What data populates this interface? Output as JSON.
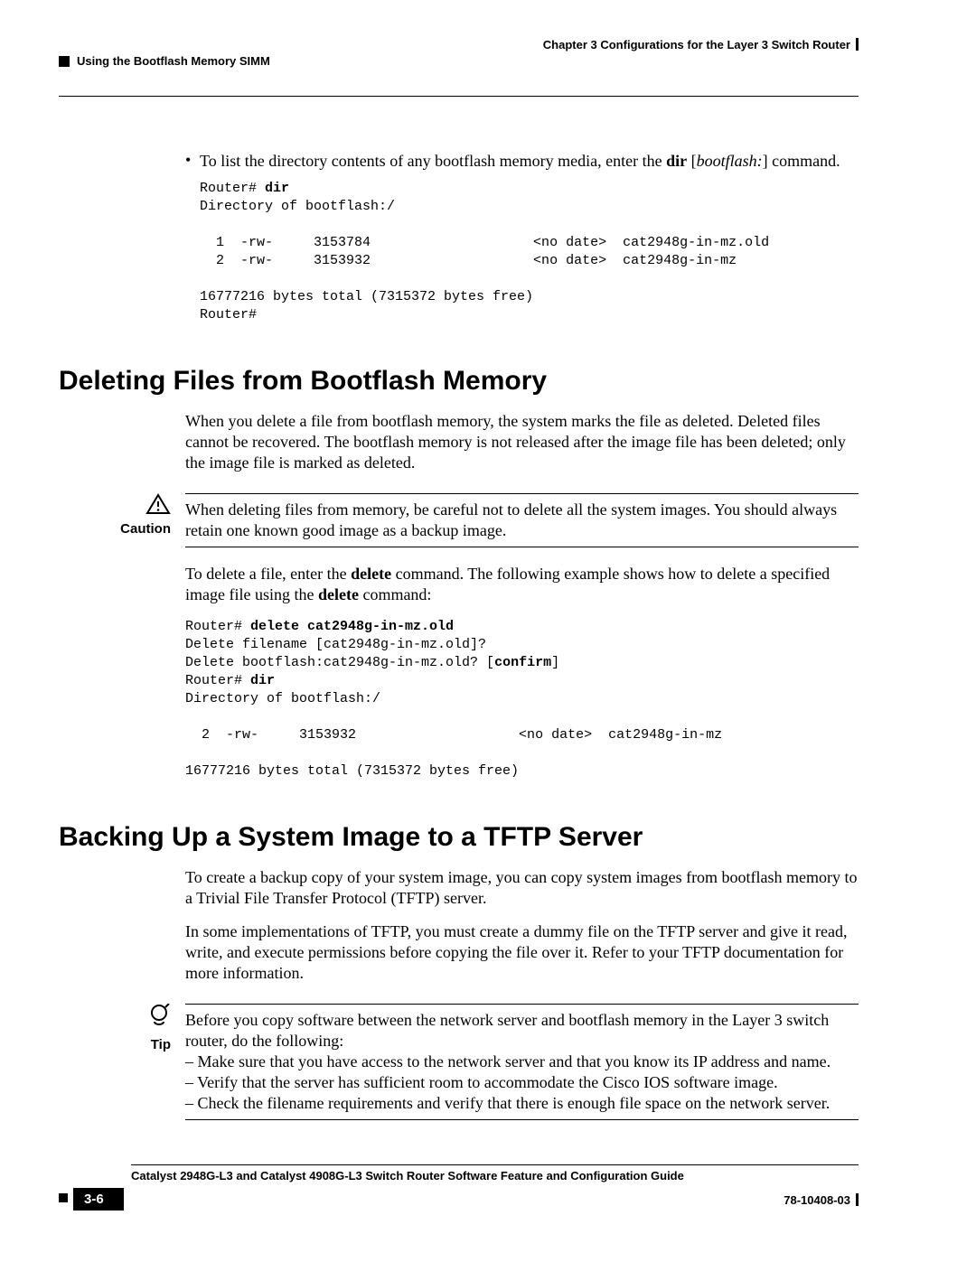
{
  "header": {
    "chapter": "Chapter 3      Configurations for the Layer 3 Switch Router",
    "section": "Using the Bootflash Memory SIMM"
  },
  "intro_bullet": {
    "pre": "To list the directory contents of any bootflash memory media, enter the ",
    "cmd": "dir",
    "brk_open": " [",
    "arg": "bootflash:",
    "brk_close": "]",
    "post": " command."
  },
  "code1": {
    "l1a": "Router# ",
    "l1b": "dir",
    "l2": "Directory of bootflash:/",
    "l3": "",
    "l4": "  1  -rw-     3153784                    <no date>  cat2948g-in-mz.old",
    "l5": "  2  -rw-     3153932                    <no date>  cat2948g-in-mz",
    "l6": "",
    "l7": "16777216 bytes total (7315372 bytes free)",
    "l8": "Router#"
  },
  "sect1": {
    "title": "Deleting Files from Bootflash Memory",
    "p1": "When you delete a file from bootflash memory, the system marks the file as deleted. Deleted files cannot be recovered. The bootflash memory is not released after the image file has been deleted; only the image file is marked as deleted.",
    "caution_label": "Caution",
    "caution_text": "When deleting files from memory, be careful not to delete all the system images. You should always retain one known good image as a backup image.",
    "p2_a": "To delete a file, enter the ",
    "p2_b": "delete",
    "p2_c": " command. The following example shows how to delete a specified image file using the ",
    "p2_d": "delete",
    "p2_e": " command:"
  },
  "code2": {
    "l1a": "Router# ",
    "l1b": "delete cat2948g-in-mz.old",
    "l2": "Delete filename [cat2948g-in-mz.old]?",
    "l3a": "Delete bootflash:cat2948g-in-mz.old? [",
    "l3b": "confirm",
    "l3c": "]",
    "l4a": "Router# ",
    "l4b": "dir",
    "l5": "Directory of bootflash:/",
    "l6": "",
    "l7": "  2  -rw-     3153932                    <no date>  cat2948g-in-mz",
    "l8": "",
    "l9": "16777216 bytes total (7315372 bytes free)"
  },
  "sect2": {
    "title": "Backing Up a System Image to a TFTP Server",
    "p1": "To create a backup copy of your system image, you can copy system images from bootflash memory to a Trivial File Transfer Protocol (TFTP) server.",
    "p2": "In some implementations of TFTP, you must create a dummy file on the TFTP server and give it read, write, and execute permissions before copying the file over it. Refer to your TFTP documentation for more information.",
    "tip_label": "Tip",
    "tip_intro": "Before you copy software between the network server and bootflash memory in the Layer 3 switch router, do the following:",
    "tip_li1": "– Make sure that you have access to the network server and that you know its IP address and name.",
    "tip_li2": "– Verify that the server has sufficient room to accommodate the Cisco IOS software image.",
    "tip_li3": "– Check the filename requirements and verify that there is enough file space on the network server."
  },
  "footer": {
    "title": "Catalyst 2948G-L3 and Catalyst 4908G-L3 Switch Router Software Feature and Configuration Guide",
    "page": "3-6",
    "docnum": "78-10408-03"
  }
}
